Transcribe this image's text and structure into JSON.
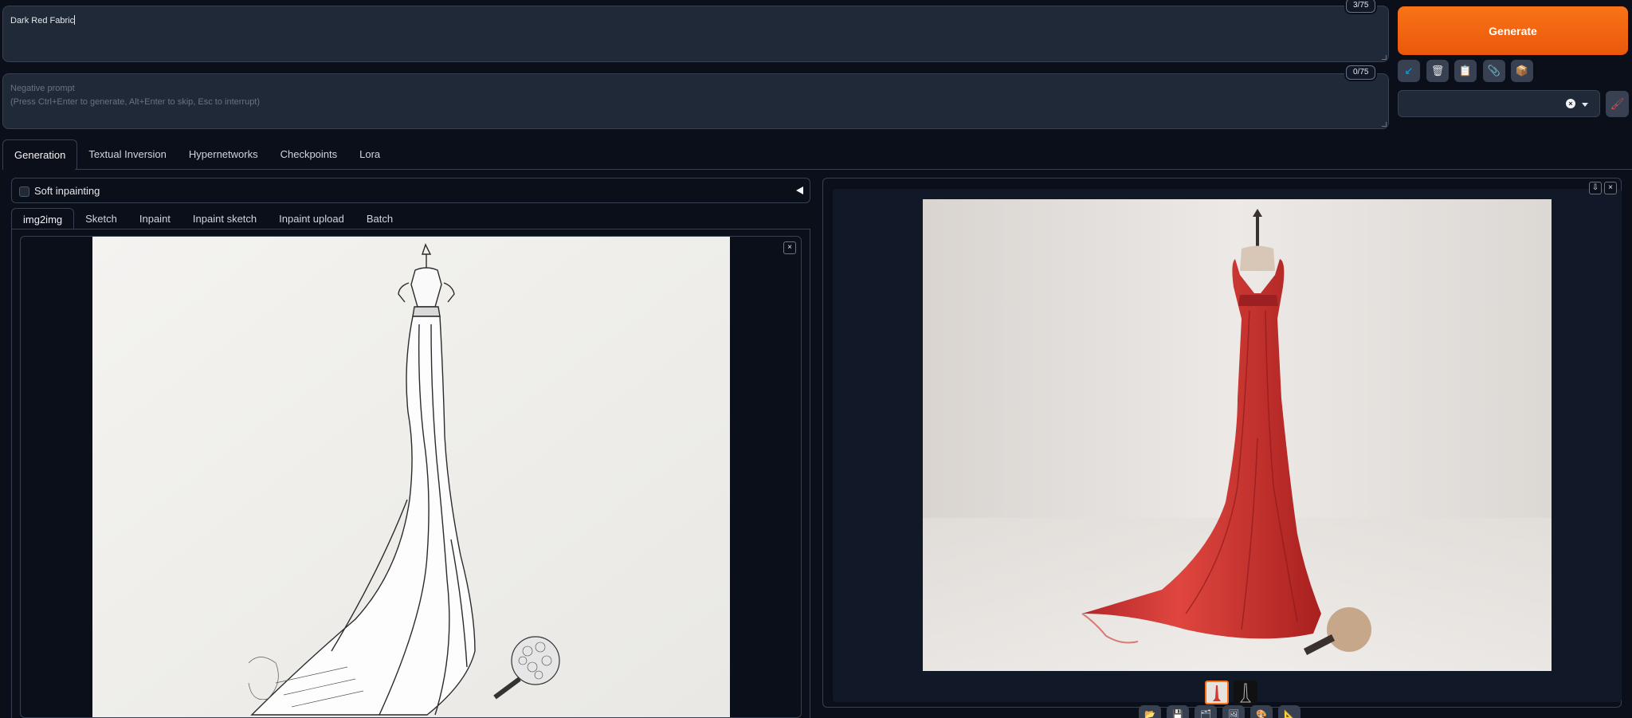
{
  "prompt": {
    "value": "Dark Red Fabric",
    "counter": "3/75"
  },
  "negative_prompt": {
    "placeholder": "Negative prompt\n(Press Ctrl+Enter to generate, Alt+Enter to skip, Esc to interrupt)",
    "counter": "0/75"
  },
  "generate_label": "Generate",
  "tools": [
    {
      "icon": "paste-params-icon",
      "glyph": "↙"
    },
    {
      "icon": "trash-icon",
      "glyph": "🗑"
    },
    {
      "icon": "clipboard-icon",
      "glyph": "📋"
    },
    {
      "icon": "paperclip-icon",
      "glyph": "📎"
    },
    {
      "icon": "package-icon",
      "glyph": "📦"
    }
  ],
  "style_select": {
    "clear": "×"
  },
  "main_tabs": [
    "Generation",
    "Textual Inversion",
    "Hypernetworks",
    "Checkpoints",
    "Lora"
  ],
  "soft_inpainting": {
    "label": "Soft inpainting",
    "checked": false
  },
  "input_tabs": [
    "img2img",
    "Sketch",
    "Inpaint",
    "Inpaint sketch",
    "Inpaint upload",
    "Batch"
  ],
  "input_image": {
    "close": "×"
  },
  "output": {
    "download": "⇩",
    "close": "×",
    "actions": [
      {
        "icon": "folder-icon",
        "glyph": "📂"
      },
      {
        "icon": "save-icon",
        "glyph": "💾"
      },
      {
        "icon": "zip-icon",
        "glyph": "🗂"
      },
      {
        "icon": "send-to-img2img-icon",
        "glyph": "🖼"
      },
      {
        "icon": "send-to-inpaint-icon",
        "glyph": "🎨"
      },
      {
        "icon": "send-to-extras-icon",
        "glyph": "📐"
      }
    ]
  },
  "colors": {
    "accent": "#f97316",
    "background": "#0b0f19",
    "panel": "#1f2937",
    "border": "#374151"
  }
}
